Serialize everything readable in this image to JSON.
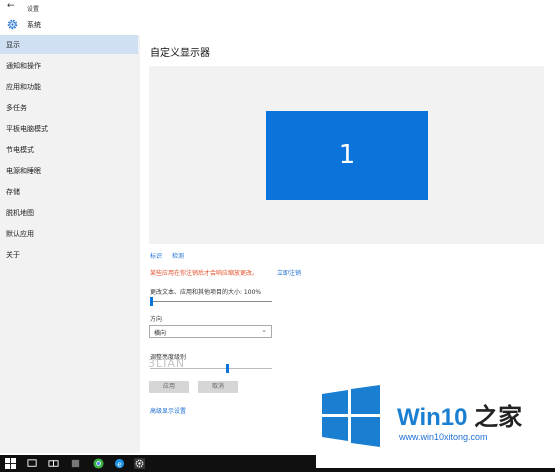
{
  "titlebar": {
    "back_glyph": "←",
    "title": "设置"
  },
  "header": {
    "app_name": "系统",
    "icon": "gear-icon"
  },
  "sidebar": {
    "items": [
      {
        "label": "显示",
        "active": true
      },
      {
        "label": "通知和操作",
        "active": false
      },
      {
        "label": "应用和功能",
        "active": false
      },
      {
        "label": "多任务",
        "active": false
      },
      {
        "label": "平板电脑模式",
        "active": false
      },
      {
        "label": "节电模式",
        "active": false
      },
      {
        "label": "电源和睡眠",
        "active": false
      },
      {
        "label": "存储",
        "active": false
      },
      {
        "label": "脱机地图",
        "active": false
      },
      {
        "label": "默认应用",
        "active": false
      },
      {
        "label": "关于",
        "active": false
      }
    ],
    "active_color": "#cfe0f3"
  },
  "main": {
    "title": "自定义显示器",
    "monitor_number": "1",
    "monitor_color": "#0a74da",
    "identify_link": "标识",
    "detect_link": "检测",
    "warning": "某些应用在你注销后才会响应缩放更改。",
    "signout_link": "立即注销",
    "scale_label": "更改文本、应用和其他项目的大小: 100%",
    "scale_value_percent": 100,
    "orientation_label": "方向",
    "orientation_value": "横向",
    "brightness_label": "调整亮度级别",
    "apply_button": "应用",
    "cancel_button": "取消",
    "advanced_link": "高级显示设置"
  },
  "watermark": {
    "text": "3LIAN"
  },
  "brand": {
    "name_a": "Win10",
    "name_b": " 之家",
    "url": "www.win10xitong.com",
    "color": "#1b7fd1"
  },
  "taskbar": {
    "icons": [
      "windows-start-icon",
      "search-icon",
      "task-view-icon",
      "store-icon",
      "chrome-icon",
      "ie-icon",
      "settings-icon"
    ]
  }
}
